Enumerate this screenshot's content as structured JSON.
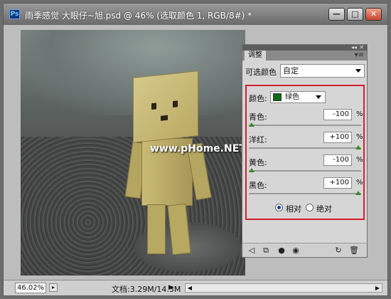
{
  "window": {
    "app_logo": "Ps",
    "title": "雨季感觉  大眼仔~旭.psd @ 46% (选取颜色 1, RGB/8#) *",
    "buttons": {
      "minimize": "—",
      "maximize": "□",
      "close": "✕"
    }
  },
  "canvas": {
    "watermark": "www.pHome.NET"
  },
  "panel": {
    "tab": "调整",
    "collapse_glyph": "◂◂",
    "close_glyph": "✕",
    "menu_glyph": "▾≡",
    "preset_label": "可选颜色",
    "preset_value": "自定",
    "color_label": "颜色:",
    "color_value": "绿色",
    "swatch_color": "#0a6c12",
    "sliders": [
      {
        "label": "青色:",
        "value": "-100",
        "unit": "%",
        "level": -100
      },
      {
        "label": "洋红:",
        "value": "+100",
        "unit": "%",
        "level": 100
      },
      {
        "label": "黄色:",
        "value": "-100",
        "unit": "%",
        "level": -100
      },
      {
        "label": "黑色:",
        "value": "+100",
        "unit": "%",
        "level": 100
      }
    ],
    "mode_relative": "相对",
    "mode_absolute": "绝对",
    "mode_selected": "relative",
    "bottom_icons": [
      "back-icon",
      "clip-icon",
      "visibility-icon",
      "view-previous-icon",
      "reset-icon",
      "delete-icon"
    ]
  },
  "statusbar": {
    "zoom": "46.02%",
    "doc_info": "文档:3.29M/14.3M"
  }
}
